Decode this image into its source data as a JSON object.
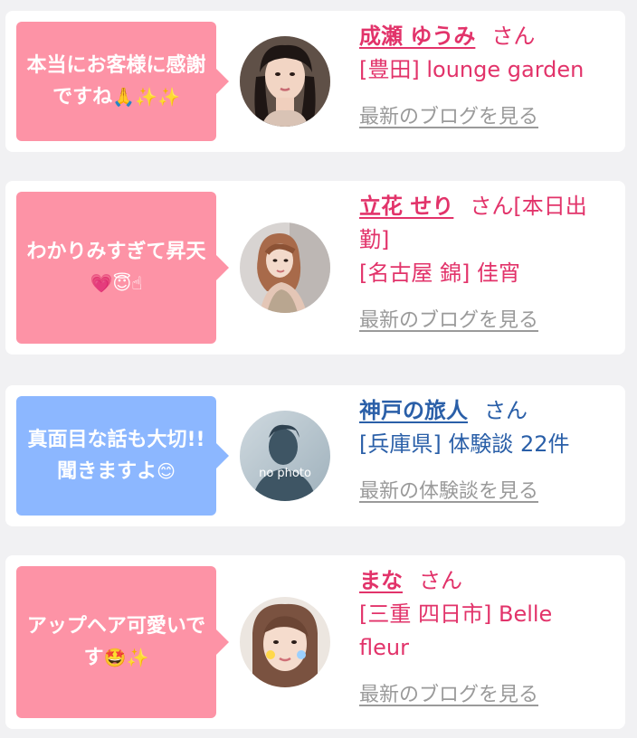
{
  "cards": [
    {
      "bubble_text": "本当にお客様に感謝ですね",
      "bubble_emoji": "🙏✨✨",
      "name": "成瀬 ゆうみ",
      "san": "さん",
      "shop": "[豊田] lounge garden",
      "link": "最新のブログを見る"
    },
    {
      "bubble_text": "わかりみすぎて昇天",
      "bubble_emoji": "💗😇☝",
      "name": "立花 せり",
      "san": "さん[本日出",
      "san_cont": "勤]",
      "shop": "[名古屋 錦] 佳宵",
      "link": "最新のブログを見る"
    },
    {
      "bubble_text": "真面目な話も大切!!聞きますよ",
      "bubble_emoji": "😊",
      "name": "神戸の旅人",
      "san": "さん",
      "shop": "[兵庫県] 体験談 22件",
      "link": "最新の体験談を見る",
      "avatar_label": "no photo"
    },
    {
      "bubble_text": "アップヘア可愛いです",
      "bubble_emoji": "🤩✨",
      "name": "まな",
      "san": "さん",
      "shop": "[三重 四日市] Belle",
      "shop_cont": "fleur",
      "link": "最新のブログを見る"
    }
  ]
}
